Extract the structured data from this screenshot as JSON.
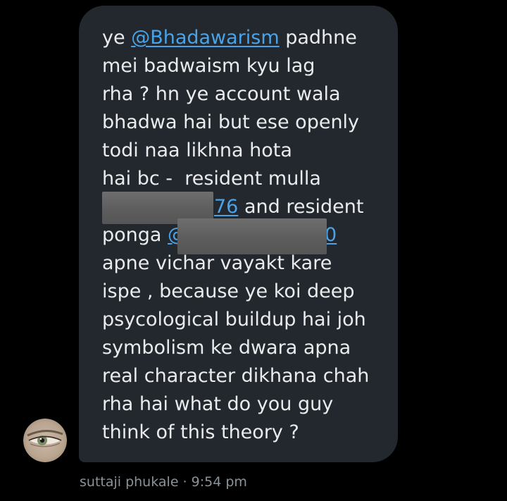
{
  "message": {
    "lines": [
      {
        "pre": "ye ",
        "mention": "@Bhadawarism",
        "post": " padhne"
      },
      {
        "text": "mei badwaism kyu lag"
      },
      {
        "text": "rha ? hn ye account wala"
      },
      {
        "text": "bhadwa hai but ese openly"
      },
      {
        "text": "todi naa likhna hota"
      },
      {
        "text": "hai bc -  resident mulla"
      },
      {
        "mention_tail": "76",
        "post": " and resident"
      },
      {
        "pre": "ponga ",
        "mention_head": "@",
        "mention_tail": "0"
      },
      {
        "text": "apne vichar vayakt kare"
      },
      {
        "text": "ispe , because ye koi deep"
      },
      {
        "text": "psycological buildup hai joh"
      },
      {
        "text": "symbolism ke dwara apna"
      },
      {
        "text": "real character dikhana chah"
      },
      {
        "text": "rha hai what do you guy"
      },
      {
        "text": "think of this theory ?"
      }
    ]
  },
  "sender": {
    "name": "suttaji phukale",
    "separator": " · ",
    "time": "9:54 pm"
  },
  "colors": {
    "background": "#000000",
    "bubble": "#22282d",
    "text": "#e9ebed",
    "mention": "#4aa3e8",
    "meta": "#8b9399"
  }
}
